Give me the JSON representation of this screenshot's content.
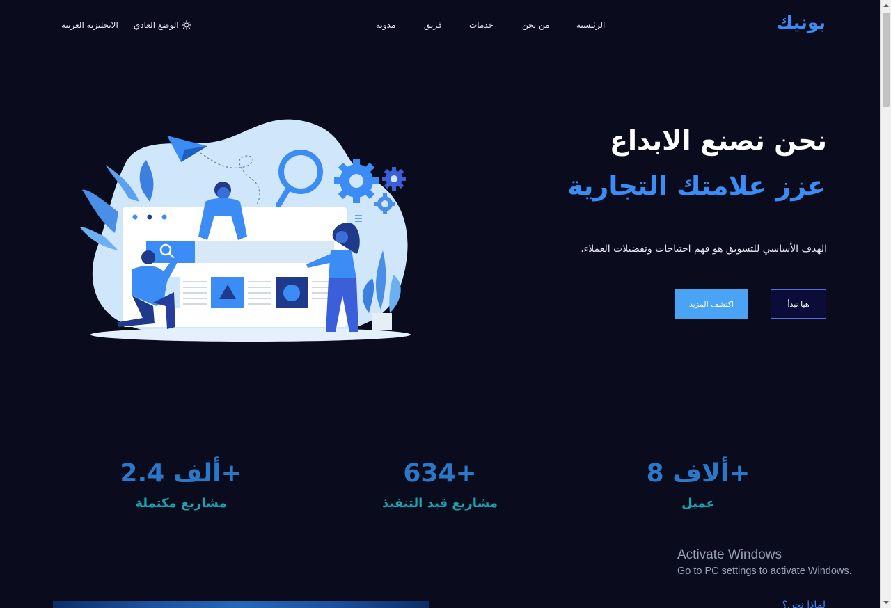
{
  "nav": {
    "brand": "بونيك",
    "links": [
      "الرئيسية",
      "من نحن",
      "خدمات",
      "فريق",
      "مدونة"
    ],
    "theme_toggle": "الوضع العادي",
    "language_toggle": "الانجليزية العربية"
  },
  "hero": {
    "title_line1": "نحن نصنع الابداع",
    "title_line2": "عزز علامتك التجارية",
    "description": "الهدف الأساسي للتسويق هو فهم احتياجات وتفضيلات العملاء.",
    "primary_button": "هيا نبدأ",
    "secondary_button": "اكتشف المزيد"
  },
  "stats": [
    {
      "value": "8 ألاف+",
      "label": "عميل"
    },
    {
      "value": "634+",
      "label": "مشاريع قيد التنفيذ"
    },
    {
      "value": "2.4 ألف+",
      "label": "مشاريع مكتملة"
    }
  ],
  "watermark": {
    "title": "Activate Windows",
    "subtitle": "Go to PC settings to activate Windows."
  },
  "next_section": {
    "heading": "لماذا نحن؟"
  },
  "colors": {
    "background": "#0a0c1e",
    "accent": "#3b8cf5",
    "stat_value": "#2b78c8",
    "stat_label": "#1aa3b0",
    "primary_button_bg": "#0c0c3a",
    "secondary_button_bg": "#4aa3f5"
  },
  "icons": {
    "theme": "sun-icon",
    "scroll_up": "chevron-up-icon",
    "scroll_down": "chevron-down-icon"
  }
}
